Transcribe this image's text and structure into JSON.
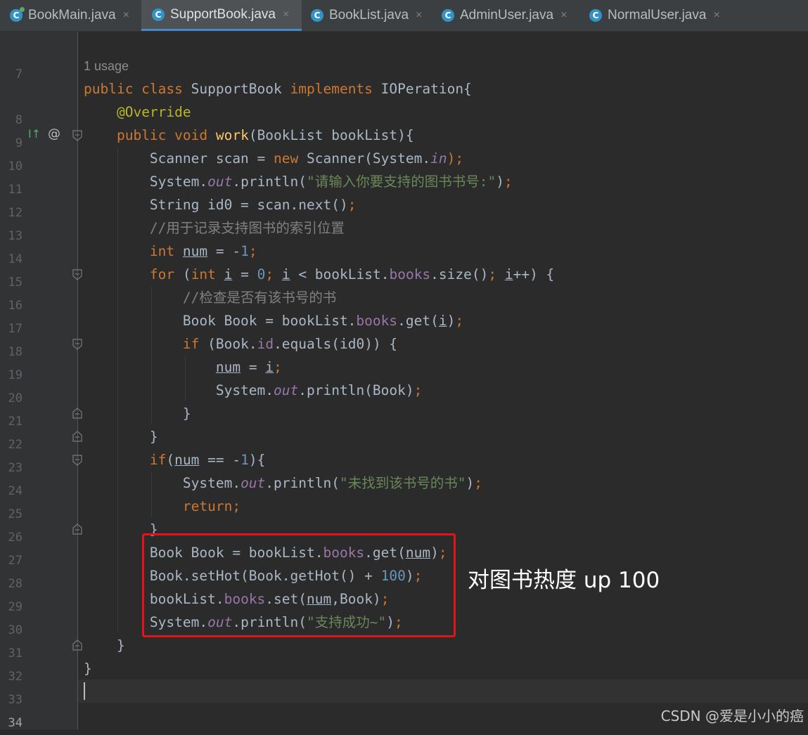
{
  "tabs": [
    {
      "label": "BookMain.java",
      "close": "×"
    },
    {
      "label": "SupportBook.java",
      "close": "×"
    },
    {
      "label": "BookList.java",
      "close": "×"
    },
    {
      "label": "AdminUser.java",
      "close": "×"
    },
    {
      "label": "NormalUser.java",
      "close": "×"
    }
  ],
  "class_icon_letter": "C",
  "active_tab_index": 1,
  "usage_hint": "1 usage",
  "line_numbers": [
    "7",
    "8",
    "9",
    "10",
    "11",
    "12",
    "13",
    "14",
    "15",
    "16",
    "17",
    "18",
    "19",
    "20",
    "21",
    "22",
    "23",
    "24",
    "25",
    "26",
    "27",
    "28",
    "29",
    "30",
    "31",
    "32",
    "33",
    "34"
  ],
  "current_line": "34",
  "gutter_icons": {
    "implements": "I↑",
    "at": "@"
  },
  "annotation_text": "对图书热度 up 100",
  "watermark": "CSDN @爱是小小的癌",
  "colors": {
    "highlight_border": "#e0151b",
    "keyword": "#cc7832",
    "string": "#6a8759",
    "number": "#6897bb",
    "field": "#9876aa",
    "method": "#ffc66d",
    "annotation": "#bbb529",
    "comment": "#808080"
  }
}
